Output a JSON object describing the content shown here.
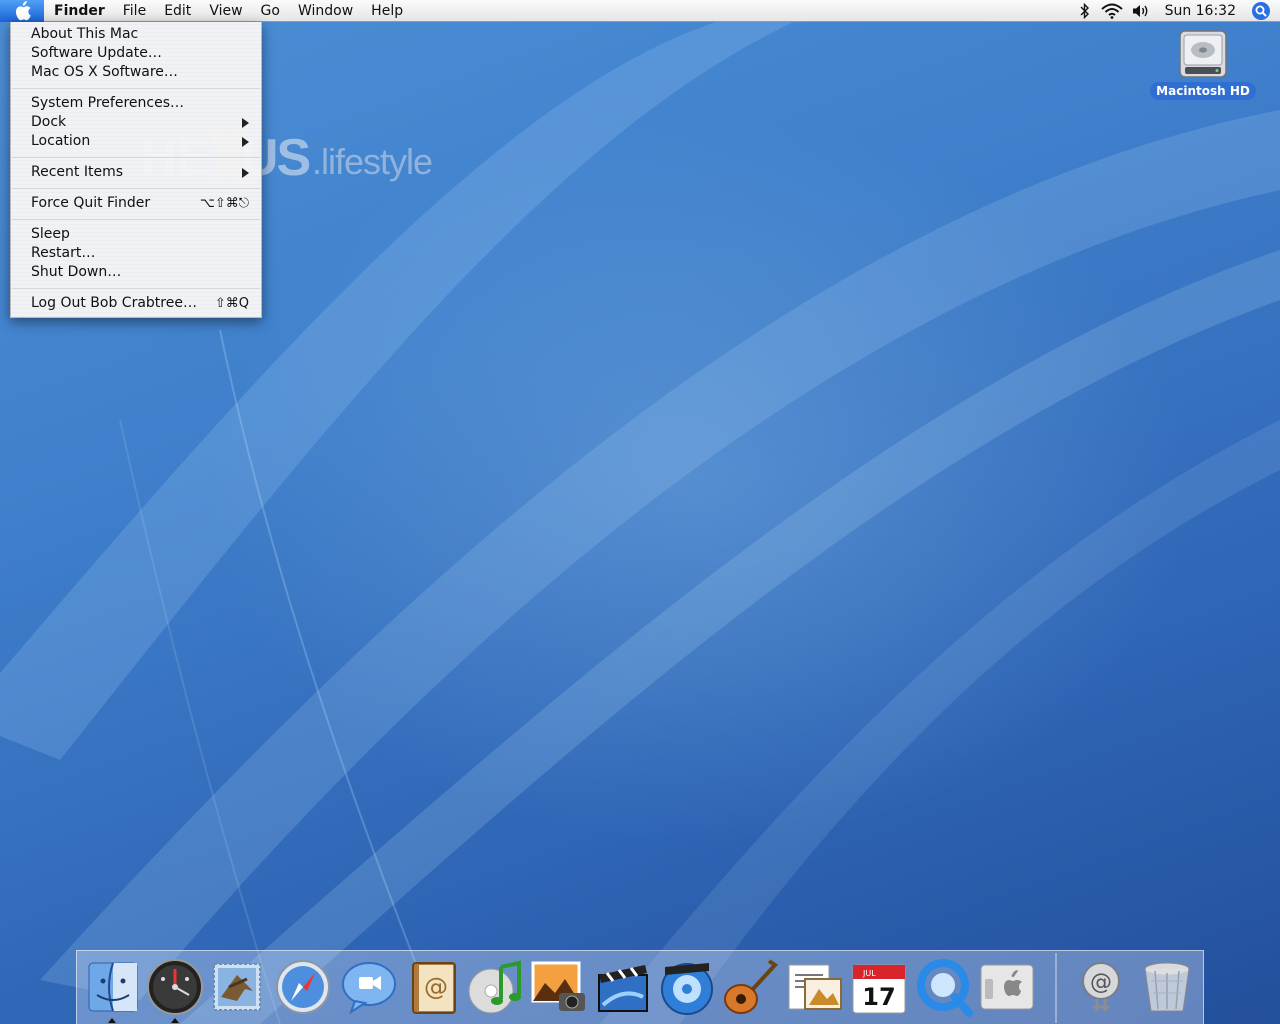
{
  "menubar": {
    "apple_icon": "apple-icon",
    "app_name": "Finder",
    "menus": [
      "File",
      "Edit",
      "View",
      "Go",
      "Window",
      "Help"
    ],
    "status_icons": [
      "bluetooth-icon",
      "wifi-icon",
      "volume-icon"
    ],
    "clock": "Sun 16:32",
    "spotlight_icon": "spotlight-icon"
  },
  "apple_menu": {
    "items": [
      {
        "label": "About This Mac"
      },
      {
        "label": "Software Update…"
      },
      {
        "label": "Mac OS X Software…"
      },
      {
        "label": "System Preferences…"
      },
      {
        "label": "Dock",
        "submenu": true
      },
      {
        "label": "Location",
        "submenu": true
      },
      {
        "label": "Recent Items",
        "submenu": true
      },
      {
        "label": "Force Quit Finder",
        "shortcut": "⌥⇧⌘⎋"
      },
      {
        "label": "Sleep"
      },
      {
        "label": "Restart…"
      },
      {
        "label": "Shut Down…"
      },
      {
        "label": "Log Out Bob Crabtree…",
        "shortcut": "⇧⌘Q"
      }
    ]
  },
  "watermark": {
    "brand": "HEXUS",
    "suffix": ".lifestyle"
  },
  "desktop_icons": [
    {
      "label": "Macintosh HD",
      "icon": "hard-drive-icon"
    }
  ],
  "dock": {
    "apps": [
      {
        "icon": "finder-icon",
        "running": true
      },
      {
        "icon": "dashboard-icon",
        "running": true
      },
      {
        "icon": "mail-icon",
        "running": false
      },
      {
        "icon": "safari-icon",
        "running": false
      },
      {
        "icon": "ichat-icon",
        "running": false
      },
      {
        "icon": "address-book-icon",
        "running": false
      },
      {
        "icon": "itunes-icon",
        "running": false
      },
      {
        "icon": "iphoto-icon",
        "running": false
      },
      {
        "icon": "imovie-icon",
        "running": false
      },
      {
        "icon": "idvd-icon",
        "running": false
      },
      {
        "icon": "garageband-icon",
        "running": false
      },
      {
        "icon": "preview-icon",
        "running": false
      },
      {
        "icon": "ical-icon",
        "running": false
      },
      {
        "icon": "quicktime-icon",
        "running": false
      },
      {
        "icon": "system-preferences-icon",
        "running": false
      }
    ],
    "ical_month": "JUL",
    "ical_day": "17",
    "right_items": [
      {
        "icon": "internet-location-icon"
      },
      {
        "icon": "trash-icon"
      }
    ]
  },
  "colors": {
    "desktop": "#3a79c6",
    "menu_highlight": "#1c63d6",
    "label_blue": "#2f6fd4"
  }
}
